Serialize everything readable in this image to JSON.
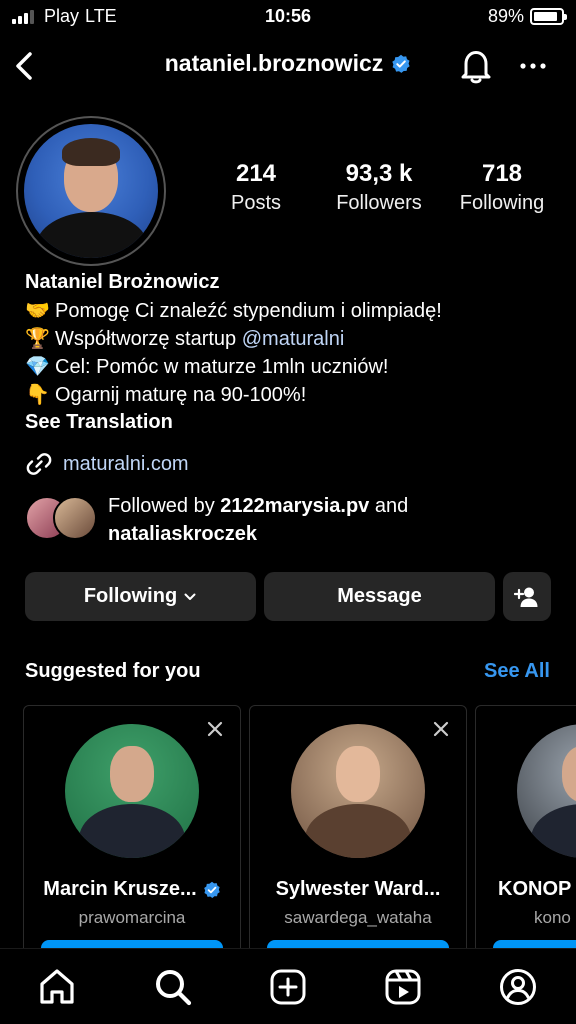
{
  "status_bar": {
    "carrier": "Play",
    "network": "LTE",
    "time": "10:56",
    "battery": "89%",
    "battery_level": 0.89
  },
  "header": {
    "username": "nataniel.broznowicz",
    "back_icon": "chevron-left-icon",
    "bell_icon": "bell-icon",
    "more_icon": "more-horizontal-icon"
  },
  "stats": {
    "posts": {
      "value": "214",
      "label": "Posts"
    },
    "followers": {
      "value": "93,3 k",
      "label": "Followers"
    },
    "following": {
      "value": "718",
      "label": "Following"
    }
  },
  "bio": {
    "full_name": "Nataniel Brożnowicz",
    "lines": [
      {
        "emoji": "🤝",
        "text": "Pomogę Ci znaleźć stypendium i olimpiadę!"
      },
      {
        "emoji": "🏆",
        "text": "Współtworzę startup ",
        "mention": "@maturalni"
      },
      {
        "emoji": "💎",
        "text": "Cel: Pomóc w maturze 1mln uczniów!"
      },
      {
        "emoji": "👇",
        "text": "Ogarnij maturę na 90-100%!"
      }
    ],
    "see_translation": "See Translation",
    "link": "maturalni.com"
  },
  "followed_by": {
    "prefix": "Followed by ",
    "user1": "2122marysia.pv",
    "conj": " and",
    "user2": "nataliaskroczek"
  },
  "actions": {
    "following_label": "Following",
    "message_label": "Message"
  },
  "suggested": {
    "title": "Suggested for you",
    "see_all": "See All",
    "cards": [
      {
        "name": "Marcin Krusze...",
        "handle": "prawomarcina",
        "verified": true
      },
      {
        "name": "Sylwester Ward...",
        "handle": "sawardega_wataha",
        "verified": false
      },
      {
        "name": "KONOP",
        "handle": "kono",
        "verified": false
      }
    ]
  },
  "colors": {
    "accent": "#3797f0",
    "follow_button": "#0095f6",
    "verified": "#3797f0",
    "link": "#c0d6f7"
  }
}
